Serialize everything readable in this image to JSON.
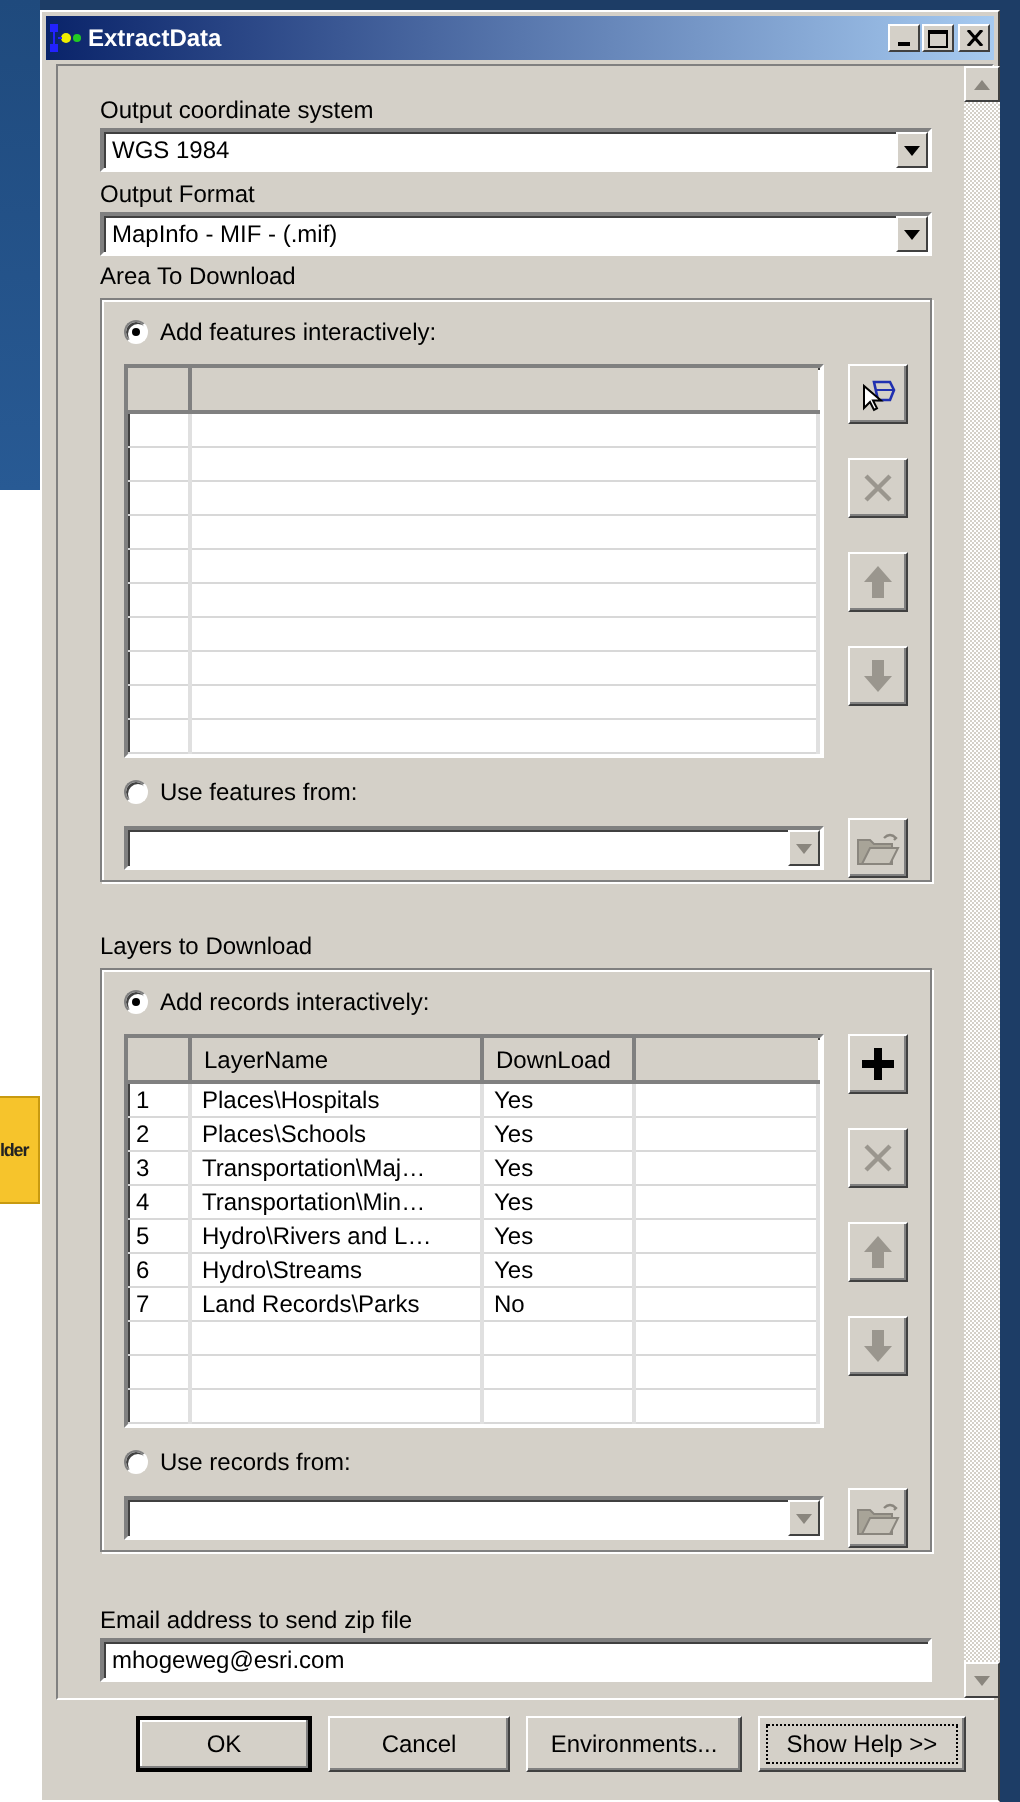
{
  "background": {
    "button_label": "lder"
  },
  "window": {
    "title": "ExtractData"
  },
  "fields": [
    {
      "label": "Output coordinate system",
      "value": "WGS 1984"
    },
    {
      "label": "Output Format",
      "value": "MapInfo - MIF - (.mif)"
    }
  ],
  "area": {
    "title": "Area To Download",
    "options": [
      {
        "label": "Add features interactively:",
        "selected": true
      },
      {
        "label": "Use features from:",
        "selected": false
      }
    ],
    "tools": [
      {
        "kind": "select",
        "disabled": false
      },
      {
        "kind": "delete",
        "disabled": true
      },
      {
        "kind": "up",
        "disabled": true
      },
      {
        "kind": "down",
        "disabled": true
      }
    ]
  },
  "layers": {
    "title": "Layers to Download",
    "options": [
      {
        "label": "Add records interactively:",
        "selected": true
      },
      {
        "label": "Use records from:",
        "selected": false
      }
    ],
    "columns": [
      "LayerName",
      "DownLoad"
    ],
    "rows": [
      {
        "index": "1",
        "layer_name": "Places\\Hospitals",
        "download": "Yes"
      },
      {
        "index": "2",
        "layer_name": "Places\\Schools",
        "download": "Yes"
      },
      {
        "index": "3",
        "layer_name": "Transportation\\Maj…",
        "download": "Yes"
      },
      {
        "index": "4",
        "layer_name": "Transportation\\Min…",
        "download": "Yes"
      },
      {
        "index": "5",
        "layer_name": "Hydro\\Rivers and L…",
        "download": "Yes"
      },
      {
        "index": "6",
        "layer_name": "Hydro\\Streams",
        "download": "Yes"
      },
      {
        "index": "7",
        "layer_name": "Land Records\\Parks",
        "download": "No"
      }
    ],
    "tools": [
      {
        "kind": "add",
        "disabled": false
      },
      {
        "kind": "delete",
        "disabled": true
      },
      {
        "kind": "up",
        "disabled": true
      },
      {
        "kind": "down",
        "disabled": true
      }
    ]
  },
  "email": {
    "label": "Email address to send zip file",
    "value": "mhogeweg@esri.com"
  },
  "buttons": [
    {
      "label": "OK",
      "default": true,
      "focused": false
    },
    {
      "label": "Cancel",
      "default": false,
      "focused": false
    },
    {
      "label": "Environments...",
      "default": false,
      "focused": false
    },
    {
      "label": "Show Help >>",
      "default": false,
      "focused": true
    }
  ]
}
